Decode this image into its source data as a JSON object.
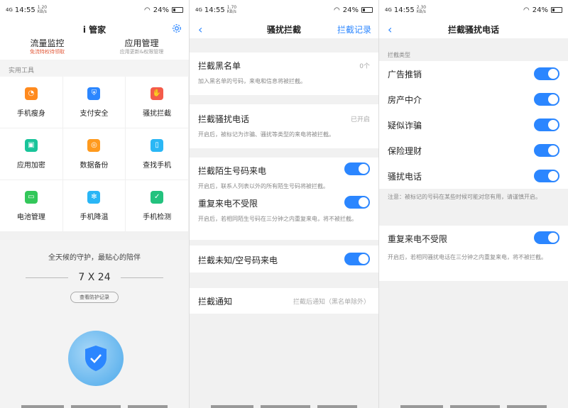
{
  "status": {
    "time": "14:55",
    "signal": "4G",
    "battery": "24%",
    "net1": "1.20 KB/s",
    "net2": "1.70 KB/s",
    "net3": "2.30 KB/s"
  },
  "p1": {
    "title": "i 管家",
    "settings_icon": "gear-icon",
    "traffic_label": "流量监控",
    "traffic_sub": "免流特权待领取",
    "apps_label": "应用管理",
    "apps_sub": "应用更新&权限管理",
    "section": "实用工具",
    "tools": [
      {
        "label": "手机瘦身",
        "icon": "pie-icon",
        "color": "#ff8a1e"
      },
      {
        "label": "支付安全",
        "icon": "shield-icon",
        "color": "#2b86ff"
      },
      {
        "label": "骚扰拦截",
        "icon": "hand-icon",
        "color": "#f45b4a"
      },
      {
        "label": "应用加密",
        "icon": "lock-icon",
        "color": "#19c49a"
      },
      {
        "label": "数据备份",
        "icon": "backup-icon",
        "color": "#ff9a1e"
      },
      {
        "label": "查找手机",
        "icon": "phone-icon",
        "color": "#2bb7f5"
      },
      {
        "label": "电池管理",
        "icon": "battery-icon",
        "color": "#33c75a"
      },
      {
        "label": "手机降温",
        "icon": "snow-icon",
        "color": "#29b6f6"
      },
      {
        "label": "手机检测",
        "icon": "check-icon",
        "color": "#23c27e"
      }
    ],
    "slogan": "全天候的守护，最贴心的陪伴",
    "guard": "7 X 24",
    "record_btn": "查看防护记录"
  },
  "p2": {
    "title": "骚扰拦截",
    "right": "拦截记录",
    "blacklist": "拦截黑名单",
    "blacklist_val": "0个",
    "blacklist_desc": "加入黑名单的号码，来电和信息将被拦截。",
    "spam": "拦截骚扰电话",
    "spam_val": "已开启",
    "spam_desc": "开启后，被标记为诈骗、骚扰等类型的来电将被拦截。",
    "stranger": "拦截陌生号码来电",
    "stranger_desc": "开启后，联系人列表以外的所有陌生号码将被拦截。",
    "repeat": "重复来电不受限",
    "repeat_desc": "开启后，若相同陌生号码在三分钟之内重复来电，将不被拦截。",
    "unknown": "拦截未知/空号码来电",
    "notify": "拦截通知",
    "notify_val": "拦截后通知（黑名单除外）"
  },
  "p3": {
    "title": "拦截骚扰电话",
    "section": "拦截类型",
    "types": [
      "广告推销",
      "房产中介",
      "疑似诈骗",
      "保险理财",
      "骚扰电话"
    ],
    "note": "注意：被标记的号码在某些时候可能对您有用，请谨慎开启。",
    "repeat": "重复来电不受限",
    "repeat_desc": "开启后，若相同骚扰电话在三分钟之内重复来电，将不被拦截。"
  }
}
